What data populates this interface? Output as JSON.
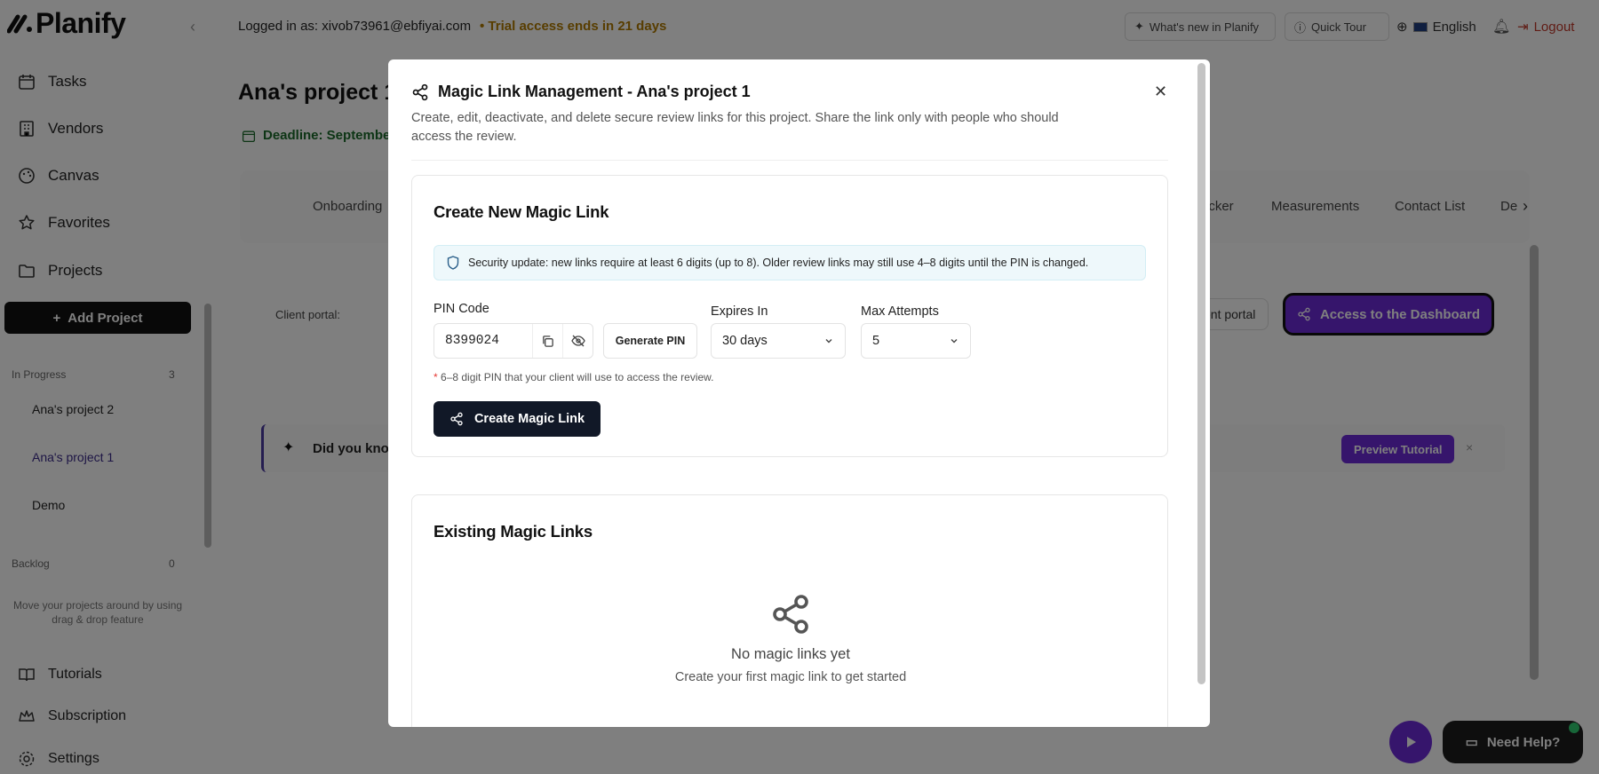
{
  "app": {
    "logo": "Planify",
    "logged_in": "Logged in as: xivob73961@ebfiyai.com",
    "trial": "Trial access ends in 21 days",
    "whats_new": "What's new in Planify",
    "quick_tour": "Quick Tour",
    "language": "English",
    "logout": "Logout"
  },
  "sidebar": {
    "nav": [
      {
        "label": "Tasks",
        "icon": "calendar-icon"
      },
      {
        "label": "Vendors",
        "icon": "building-icon"
      },
      {
        "label": "Canvas",
        "icon": "palette-icon"
      },
      {
        "label": "Favorites",
        "icon": "star-icon"
      },
      {
        "label": "Projects",
        "icon": "folder-icon"
      }
    ],
    "add_project": "Add Project",
    "in_progress_label": "In Progress",
    "in_progress_count": "3",
    "projects": [
      "Ana's project 2",
      "Ana's project 1",
      "Demo"
    ],
    "backlog_label": "Backlog",
    "backlog_count": "0",
    "backlog_hint": "Move your projects around by using drag & drop feature",
    "bottom": [
      {
        "label": "Tutorials",
        "icon": "book-icon"
      },
      {
        "label": "Subscription",
        "icon": "crown-icon"
      },
      {
        "label": "Settings",
        "icon": "gear-icon"
      }
    ]
  },
  "project": {
    "title": "Ana's project 1",
    "deadline": "Deadline: September",
    "tabs": [
      "Onboarding",
      "acker",
      "Measurements",
      "Contact List",
      "De"
    ],
    "client_portal_label": "Client portal:",
    "portal_btn": "ent portal",
    "dashboard_btn": "Access to the Dashboard",
    "tip_text": "Did you know",
    "preview_tutorial": "Preview Tutorial",
    "need_help": "Need Help?"
  },
  "modal": {
    "title": "Magic Link Management - Ana's project 1",
    "description": "Create, edit, deactivate, and delete secure review links for this project. Share the link only with people who should access the review.",
    "create_title": "Create New Magic Link",
    "security_note": "Security update: new links require at least 6 digits (up to 8). Older review links may still use 4–8 digits until the PIN is changed.",
    "pin_label": "PIN Code",
    "pin_value": "8399024",
    "generate_pin": "Generate PIN",
    "expires_label": "Expires In",
    "expires_value": "30 days",
    "attempts_label": "Max Attempts",
    "attempts_value": "5",
    "hint_star": "*",
    "hint": "6–8 digit PIN that your client will use to access the review.",
    "create_button": "Create Magic Link",
    "existing_title": "Existing Magic Links",
    "empty_title": "No magic links yet",
    "empty_sub": "Create your first magic link to get started"
  },
  "colors": {
    "accent": "#6c2bd9",
    "primary_dark": "#111827",
    "trial": "#b07a00",
    "logout": "#c0392b",
    "security_bg": "#eef8fb"
  }
}
